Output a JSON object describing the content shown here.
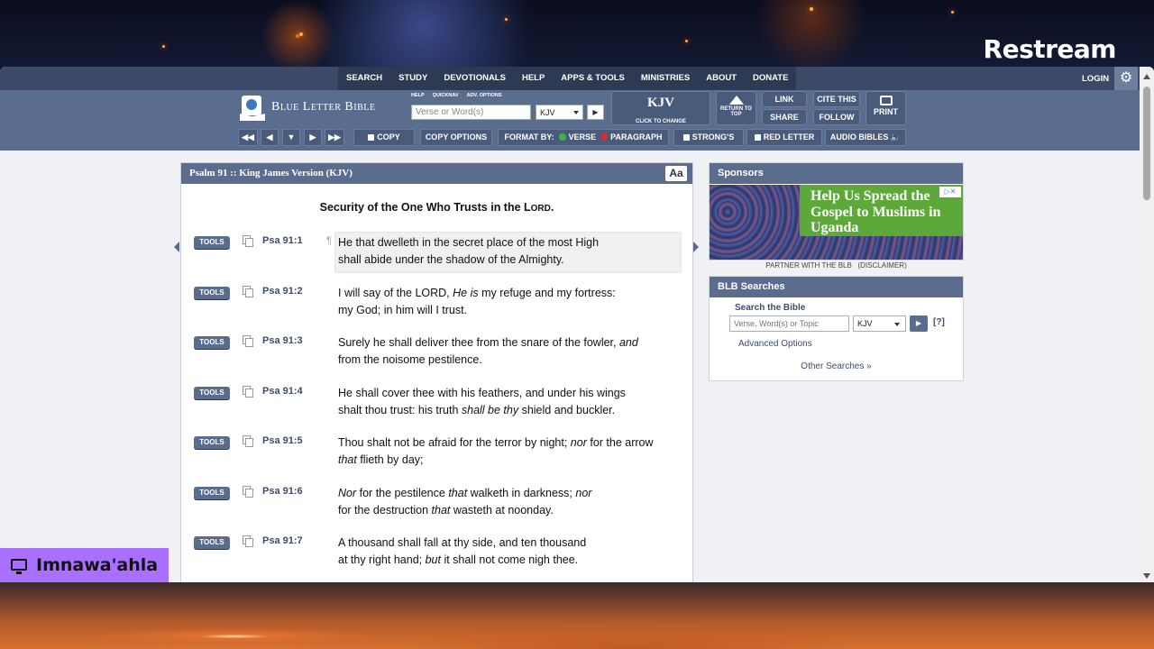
{
  "overlay": {
    "brand": "Restream",
    "channel": "Imnawa'ahla"
  },
  "topnav": {
    "items": [
      "SEARCH",
      "STUDY",
      "DEVOTIONALS",
      "HELP",
      "APPS & TOOLS",
      "MINISTRIES",
      "ABOUT",
      "DONATE"
    ],
    "login": "LOGIN"
  },
  "header": {
    "brand": "Blue Letter Bible",
    "minilinks": [
      "HELP",
      "QUICKNAV",
      "ADV. OPTIONS"
    ],
    "search_placeholder": "Verse or Word(s)",
    "version": "KJV",
    "kjv_big": "KJV",
    "kjv_small": "CLICK TO CHANGE",
    "return_top": "RETURN TO TOP",
    "link": "LINK",
    "share": "SHARE",
    "cite": "CITE THIS",
    "follow": "FOLLOW",
    "print": "PRINT"
  },
  "toolbar": {
    "copy": "COPY",
    "copy_options": "COPY OPTIONS",
    "format_by": "FORMAT BY:",
    "verse": "VERSE",
    "paragraph": "PARAGRAPH",
    "strongs": "STRONG'S",
    "red_letter": "RED LETTER",
    "audio": "AUDIO BIBLES"
  },
  "passage": {
    "header": "Psalm 91 :: King James Version (KJV)",
    "aa": "Aa",
    "section_title_pre": "Security of the One Who Trusts in the L",
    "section_title_sc": "ORD",
    "section_title_post": ".",
    "tools_label": "TOOLS",
    "verses": [
      {
        "ref": "Psa 91:1",
        "html": "He that dwelleth in the secret place of the most High<br>shall abide under the shadow of the Almighty."
      },
      {
        "ref": "Psa 91:2",
        "html": "I will say of the LORD, <i>He is</i> my refuge and my fortress:<br>my God; in him will I trust."
      },
      {
        "ref": "Psa 91:3",
        "html": "Surely he shall deliver thee from the snare of the fowler, <i>and</i><br>from the noisome pestilence."
      },
      {
        "ref": "Psa 91:4",
        "html": "He shall cover thee with his feathers, and under his wings<br>shalt thou trust: his truth <i>shall be thy</i> shield and buckler."
      },
      {
        "ref": "Psa 91:5",
        "html": "Thou shalt not be afraid for the terror by night; <i>nor</i> for the arrow<br><i>that</i> flieth by day;"
      },
      {
        "ref": "Psa 91:6",
        "html": "<i>Nor</i> for the pestilence <i>that</i> walketh in darkness; <i>nor</i><br>for the destruction <i>that</i> wasteth at noonday."
      },
      {
        "ref": "Psa 91:7",
        "html": "A thousand shall fall at thy side, and ten thousand<br>at thy right hand; <i>but</i> it shall not come nigh thee."
      }
    ]
  },
  "sponsors": {
    "header": "Sponsors",
    "ad_text": "Help Us Spread the Gospel to Muslims in Uganda",
    "partner": "PARTNER WITH THE BLB",
    "disclaimer": "(DISCLAIMER)"
  },
  "searches": {
    "header": "BLB Searches",
    "label": "Search the Bible",
    "placeholder": "Verse, Word(s) or Topic",
    "version": "KJV",
    "help": "[?]",
    "advanced": "Advanced Options",
    "other": "Other Searches"
  }
}
